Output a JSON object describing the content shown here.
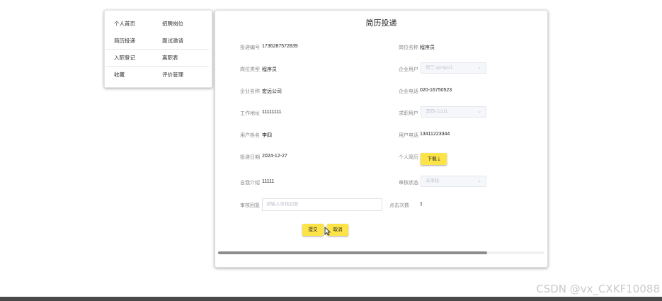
{
  "menu": {
    "items": [
      "个人首页",
      "招聘岗位",
      "简历投递",
      "面试邀请",
      "入职登记",
      "离职表",
      "收藏",
      "评价管理"
    ]
  },
  "form": {
    "title": "简历投递",
    "fields": {
      "delivery_no": {
        "label": "投递编号",
        "value": "1736287572839"
      },
      "position_name": {
        "label": "岗位名称",
        "value": "程序员"
      },
      "position_type": {
        "label": "岗位类型",
        "value": "程序员"
      },
      "company_user": {
        "label": "企业用户",
        "value": "张三-gongsi1"
      },
      "company_name": {
        "label": "企业名称",
        "value": "宏远公司"
      },
      "company_phone": {
        "label": "企业电话",
        "value": "020-16750523"
      },
      "work_address": {
        "label": "工作地址",
        "value": "11111111"
      },
      "job_seeker": {
        "label": "求职用户",
        "value": "李四-11111"
      },
      "user_name": {
        "label": "用户姓名",
        "value": "李四"
      },
      "user_phone": {
        "label": "用户电话",
        "value": "13411223344"
      },
      "delivery_date": {
        "label": "投递日期",
        "value": "2024-12-27"
      },
      "resume": {
        "label": "个人简历",
        "button": "下载 ⤓"
      },
      "self_intro": {
        "label": "自我介绍",
        "value": "11111"
      },
      "review_status": {
        "label": "审核状态",
        "value": "未审核"
      },
      "review_reply": {
        "label": "审核回复",
        "placeholder": "请输入审核回复"
      },
      "views": {
        "label": "点击次数",
        "value": "1"
      }
    },
    "submit_label": "提交",
    "cancel_label": "取消"
  },
  "watermark": "CSDN @vx_CXKF10088",
  "colors": {
    "accent_button": "#fbe348",
    "scroll_thumb": "#8c8c8c"
  }
}
